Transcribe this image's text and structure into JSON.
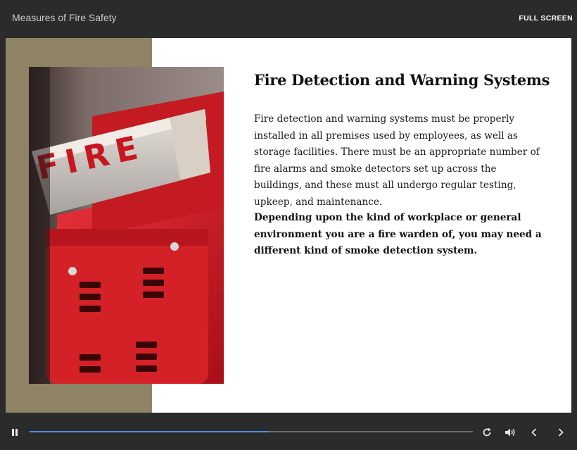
{
  "header": {
    "course_title": "Measures of Fire Safety",
    "fullscreen_label": "FULL SCREEN"
  },
  "slide": {
    "heading": "Fire Detection and Warning Systems",
    "body": "Fire detection and warning systems must be properly installed in all premises used by employees, as well as storage facilities. There must be an appropriate number of fire alarms and smoke detectors set up across the buildings, and these must all undergo regular testing, upkeep, and maintenance.",
    "emphasis": "Depending upon the kind of workplace or general environment you are a fire warden of, you may need a different kind of smoke detection system.",
    "photo_text": "FIRE"
  },
  "player": {
    "progress_fraction": 0.54,
    "icons": [
      "pause-icon",
      "replay-icon",
      "volume-icon",
      "chevron-left-icon",
      "chevron-right-icon"
    ]
  },
  "colors": {
    "background": "#2b2b2b",
    "panel_tan": "#8e8465",
    "progress": "#4a90e2",
    "alarm_red": "#d8202a"
  }
}
